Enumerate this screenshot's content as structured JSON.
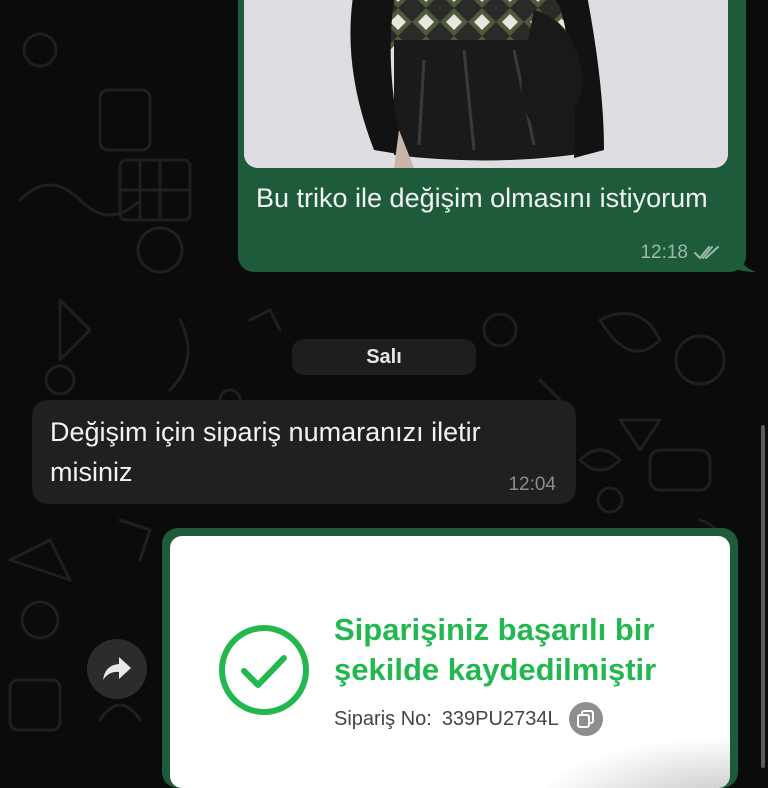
{
  "theme": {
    "background": "#0b0b0b",
    "outgoing_bubble": "#1d5b3a",
    "incoming_bubble": "#202020",
    "success_green": "#22b84f",
    "read_ticks": "#9fb9a8"
  },
  "messages": [
    {
      "direction": "outgoing",
      "type": "image",
      "image_description_icon": "fashion-photo",
      "caption": "Bu triko ile değişim olmasını istiyorum",
      "time": "12:18",
      "status_icon": "double-check-icon"
    },
    {
      "type": "date_separator",
      "label": "Salı"
    },
    {
      "direction": "incoming",
      "type": "text",
      "text": "Değişim için sipariş numaranızı iletir misiniz",
      "time": "12:04"
    },
    {
      "direction": "outgoing",
      "type": "image",
      "forward_icon": "forward-icon",
      "order_card": {
        "success_icon": "check-circle-icon",
        "title": "Siparişiniz başarılı bir şekilde kaydedilmiştir",
        "order_label": "Sipariş No:",
        "order_number": "339PU2734L",
        "copy_icon": "copy-icon"
      }
    }
  ]
}
